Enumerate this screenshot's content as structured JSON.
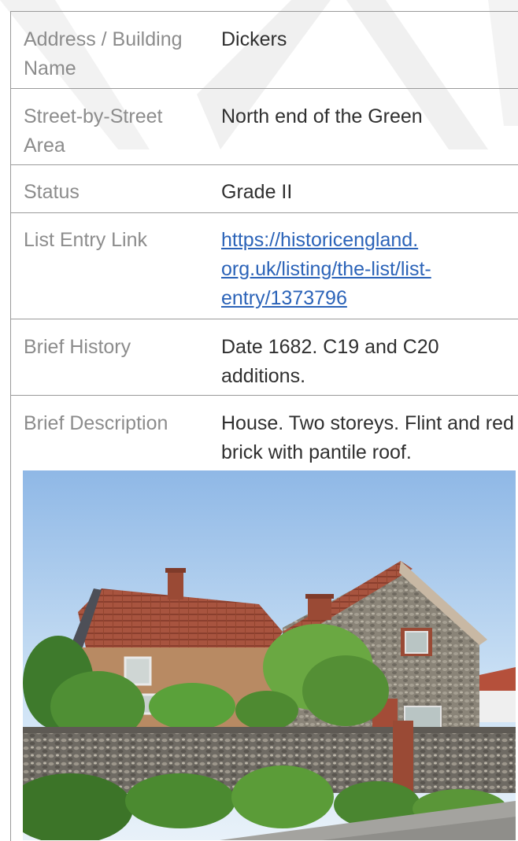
{
  "rows": [
    {
      "label": "Address / Building Name",
      "value": "Dickers"
    },
    {
      "label": "Street-by-Street Area",
      "value": "North end of the Green"
    },
    {
      "label": "Status",
      "value": "Grade II"
    },
    {
      "label": "List Entry Link",
      "value": "https://historicengland.org.uk/listing/the-list/list-entry/1373796"
    },
    {
      "label": "Brief History",
      "value": "Date 1682. C19 and C20 additions."
    },
    {
      "label": "Brief Description",
      "value": "House. Two storeys. Flint and red brick with pantile roof."
    }
  ],
  "link": {
    "line1": "https://historicengland.",
    "line2": "org.uk/listing/the-list/list-",
    "line3": "entry/1373796"
  },
  "colors": {
    "link": "#2b63b8",
    "label": "#8c8c8c",
    "text": "#2f2f2f",
    "border": "#9a9a9a"
  }
}
